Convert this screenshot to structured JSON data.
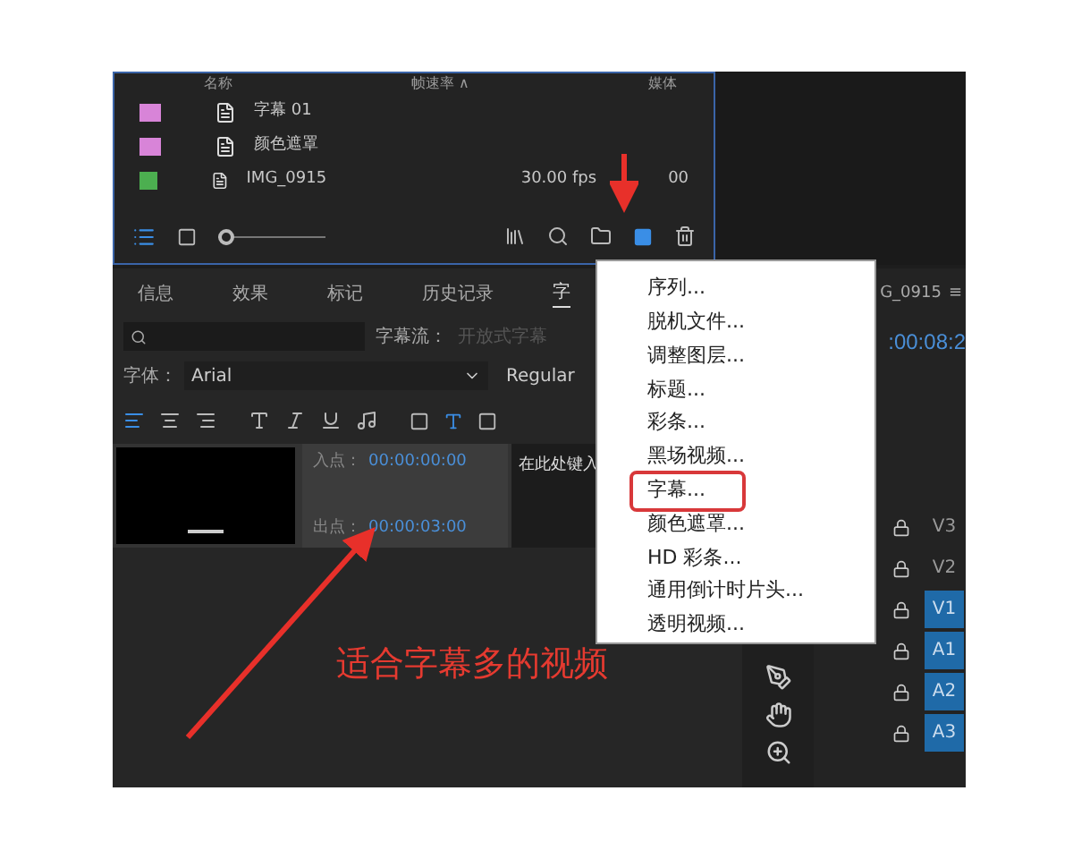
{
  "project_panel": {
    "zoom_slider": {
      "level": 0
    },
    "columns": [
      "名称",
      "帧速率 ∧",
      "媒体"
    ],
    "rows": [
      {
        "name": "字幕 01",
        "color": "#d884d8",
        "frame_rate": "",
        "media": ""
      },
      {
        "name": "颜色遮罩",
        "color": "#d884d8",
        "frame_rate": "",
        "media": ""
      },
      {
        "name": "IMG_0915",
        "color": "#4caf50",
        "frame_rate": "30.00 fps",
        "media": "00"
      }
    ]
  },
  "caption_panel": {
    "tabs": [
      {
        "label": "信息",
        "selected": false
      },
      {
        "label": "效果",
        "selected": false
      },
      {
        "label": "标记",
        "selected": false
      },
      {
        "label": "历史记录",
        "selected": false
      },
      {
        "label": "字",
        "selected": true
      }
    ],
    "stream_label": "字幕流：",
    "stream_value": "开放式字幕",
    "font_label": "字体：",
    "font_value": "Arial",
    "style_value": "Regular",
    "in_label": "入点：",
    "in_time": "00:00:00:00",
    "out_label": "出点：",
    "out_time": "00:00:03:00",
    "caption_text": "在此处键入"
  },
  "timeline": {
    "title": "G_0915",
    "menu_glyph": "≡",
    "timecode": ":00:08:2",
    "tracks": [
      {
        "label": "V3",
        "selected": false
      },
      {
        "label": "V2",
        "selected": false
      },
      {
        "label": "V1",
        "selected": true
      },
      {
        "label": "A1",
        "selected": true
      },
      {
        "label": "A2",
        "selected": true
      },
      {
        "label": "A3",
        "selected": true
      }
    ]
  },
  "new_item_menu": {
    "items": [
      {
        "label": "序列...",
        "selected": false
      },
      {
        "label": "脱机文件...",
        "selected": false
      },
      {
        "label": "调整图层...",
        "selected": false
      },
      {
        "label": "标题...",
        "selected": false
      },
      {
        "label": "彩条...",
        "selected": false
      },
      {
        "label": "黑场视频...",
        "selected": false
      },
      {
        "label": "字幕...",
        "selected": true
      },
      {
        "label": "颜色遮罩...",
        "selected": false
      },
      {
        "label": "HD 彩条...",
        "selected": false
      },
      {
        "label": "通用倒计时片头...",
        "selected": false
      },
      {
        "label": "透明视频...",
        "selected": false
      }
    ]
  },
  "annotation": "适合字幕多的视频"
}
